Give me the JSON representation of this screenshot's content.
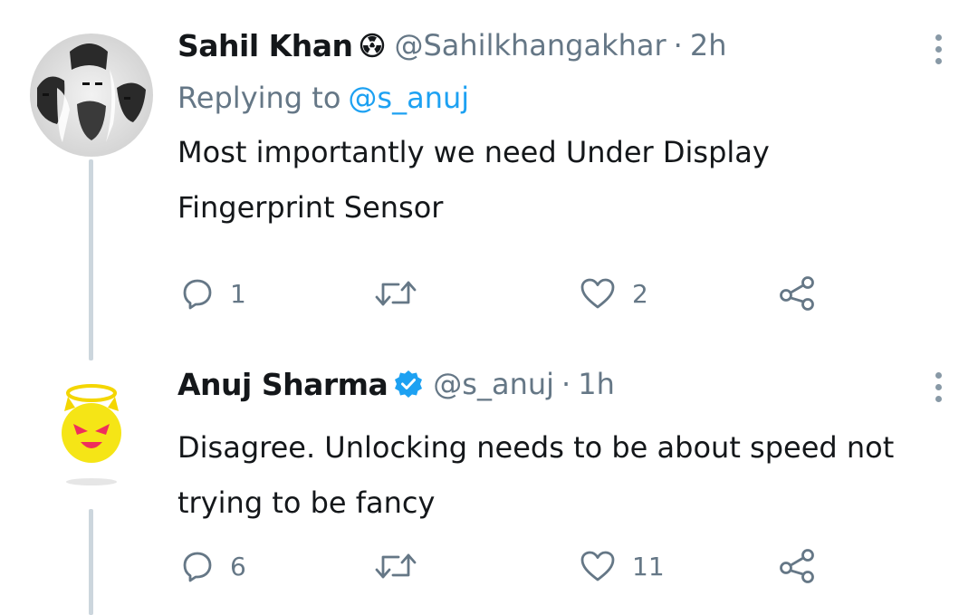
{
  "tweets": [
    {
      "name": "Sahil Khan",
      "handle": "@Sahilkhangakhar",
      "separator": "·",
      "time": "2h",
      "replying_prefix": "Replying to",
      "replying_to": "@s_anuj",
      "text_line1": "Most importantly we need Under Display",
      "text_line2": "Fingerprint Sensor",
      "replies": "1",
      "retweets": "",
      "likes": "2",
      "badge_icon": "radioactive-icon"
    },
    {
      "name": "Anuj Sharma",
      "handle": "@s_anuj",
      "separator": "·",
      "time": "1h",
      "text_line1": "Disagree. Unlocking needs to be about speed not",
      "text_line2": "trying to be fancy",
      "replies": "6",
      "retweets": "",
      "likes": "11",
      "badge_icon": "verified-badge-icon"
    }
  ],
  "colors": {
    "text_primary": "#14171a",
    "text_secondary": "#657786",
    "link": "#1da1f2",
    "verified": "#1da1f2",
    "thread_line": "#ccd6dd"
  }
}
